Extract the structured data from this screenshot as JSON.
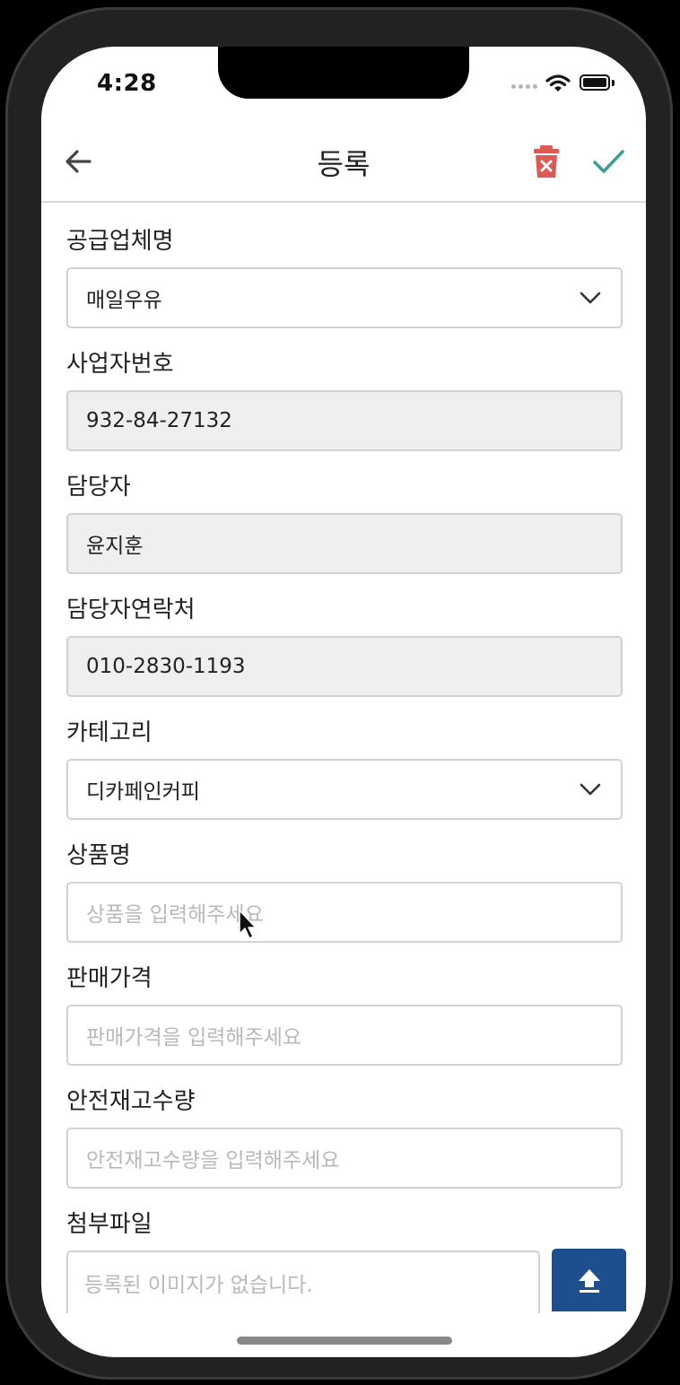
{
  "status_bar": {
    "time": "4:28"
  },
  "nav": {
    "title": "등록",
    "icons": [
      "arrow-left-icon",
      "trash-icon",
      "check-icon"
    ]
  },
  "colors": {
    "delete": "#e05a55",
    "confirm": "#3a9e93",
    "upload": "#1d4f8f"
  },
  "form": {
    "supplier": {
      "label": "공급업체명",
      "value": "매일우유"
    },
    "business_no": {
      "label": "사업자번호",
      "value": "932-84-27132"
    },
    "manager": {
      "label": "담당자",
      "value": "윤지훈"
    },
    "manager_phone": {
      "label": "담당자연락처",
      "value": "010-2830-1193"
    },
    "category": {
      "label": "카테고리",
      "value": "디카페인커피"
    },
    "product_name": {
      "label": "상품명",
      "placeholder": "상품을 입력해주세요"
    },
    "price": {
      "label": "판매가격",
      "placeholder": "판매가격을 입력해주세요"
    },
    "safety_stock": {
      "label": "안전재고수량",
      "placeholder": "안전재고수량을 입력해주세요"
    },
    "attachment": {
      "label": "첨부파일",
      "placeholder": "등록된 이미지가 없습니다."
    }
  }
}
